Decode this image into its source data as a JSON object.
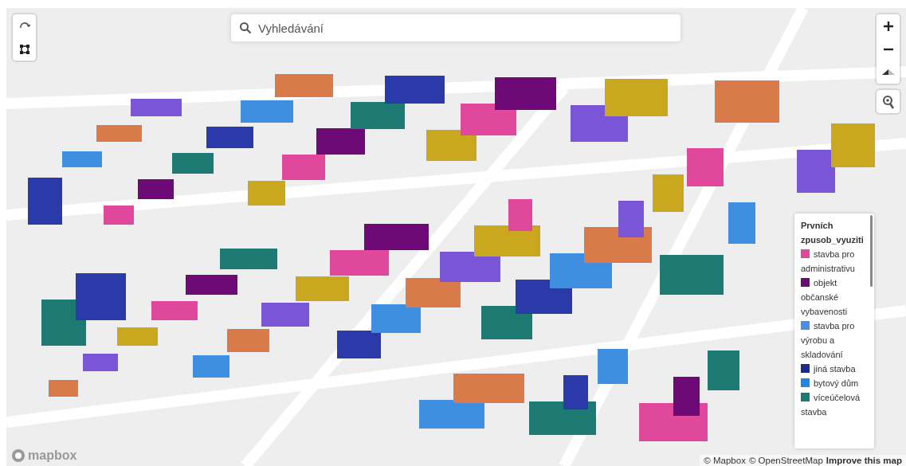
{
  "search": {
    "placeholder": "Vyhledávání"
  },
  "legend": {
    "title": "Prvních zpusob_vyuziti",
    "items": [
      {
        "label": "stavba pro administrativu",
        "color": "#e0489c"
      },
      {
        "label": "objekt občanské vybavenosti",
        "color": "#6e0a78"
      },
      {
        "label": "stavba pro výrobu a skladování",
        "color": "#4a8ee6"
      },
      {
        "label": "jiná stavba",
        "color": "#1c2a8c"
      },
      {
        "label": "bytový dům",
        "color": "#1e88e5"
      },
      {
        "label": "víceúčelová stavba",
        "color": "#1d7a72"
      }
    ]
  },
  "logo": {
    "text": "mapbox"
  },
  "attribution": [
    "© Mapbox",
    "© OpenStreetMap",
    "Improve this map"
  ]
}
